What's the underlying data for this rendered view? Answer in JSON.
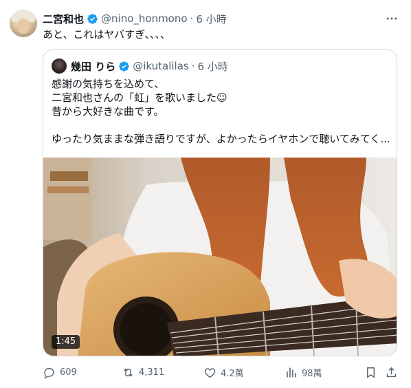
{
  "tweet": {
    "author_name": "二宮和也",
    "handle": "@nino_honmono",
    "separator": "·",
    "time": "6 小時",
    "text": "あと、これはヤバすぎ、、、、"
  },
  "quote": {
    "author_name": "幾田 りら",
    "handle": "@ikutalilas",
    "separator": "·",
    "time": "6 小時",
    "lines": [
      "感謝の気持ちを込めて、",
      "二宮和也さんの「虹」を歌いました☺",
      "昔から大好きな曲です。",
      "",
      "ゆったり気ままな弾き語りですが、よかったらイヤホンで聴いてみてく..."
    ],
    "video_duration": "1:45"
  },
  "actions": {
    "replies": "609",
    "retweets": "4,311",
    "likes": "4.2萬",
    "views": "98萬"
  },
  "colors": {
    "verified": "#1d9bf0",
    "muted": "#536471",
    "border": "#cfd9de"
  },
  "icons": [
    "more-icon",
    "verified-icon",
    "reply-icon",
    "retweet-icon",
    "like-icon",
    "views-icon",
    "bookmark-icon",
    "share-icon"
  ]
}
